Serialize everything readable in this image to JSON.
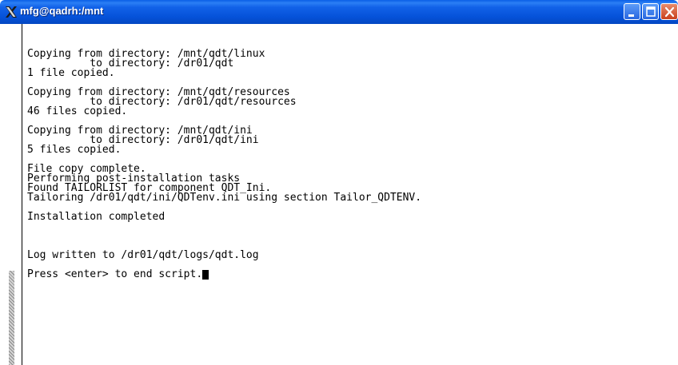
{
  "window": {
    "title": "mfg@qadrh:/mnt"
  },
  "terminal": {
    "lines": [
      "Copying from directory: /mnt/qdt/linux",
      "          to directory: /dr01/qdt",
      "1 file copied.",
      "",
      "Copying from directory: /mnt/qdt/resources",
      "          to directory: /dr01/qdt/resources",
      "46 files copied.",
      "",
      "Copying from directory: /mnt/qdt/ini",
      "          to directory: /dr01/qdt/ini",
      "5 files copied.",
      "",
      "File copy complete.",
      "Performing post-installation tasks",
      "Found TAILORLIST for component QDT_Ini.",
      "Tailoring /dr01/qdt/ini/QDTenv.ini using section Tailor_QDTENV.",
      "",
      "Installation completed",
      "",
      "",
      "",
      "Log written to /dr01/qdt/logs/qdt.log",
      "",
      "Press <enter> to end script."
    ]
  }
}
